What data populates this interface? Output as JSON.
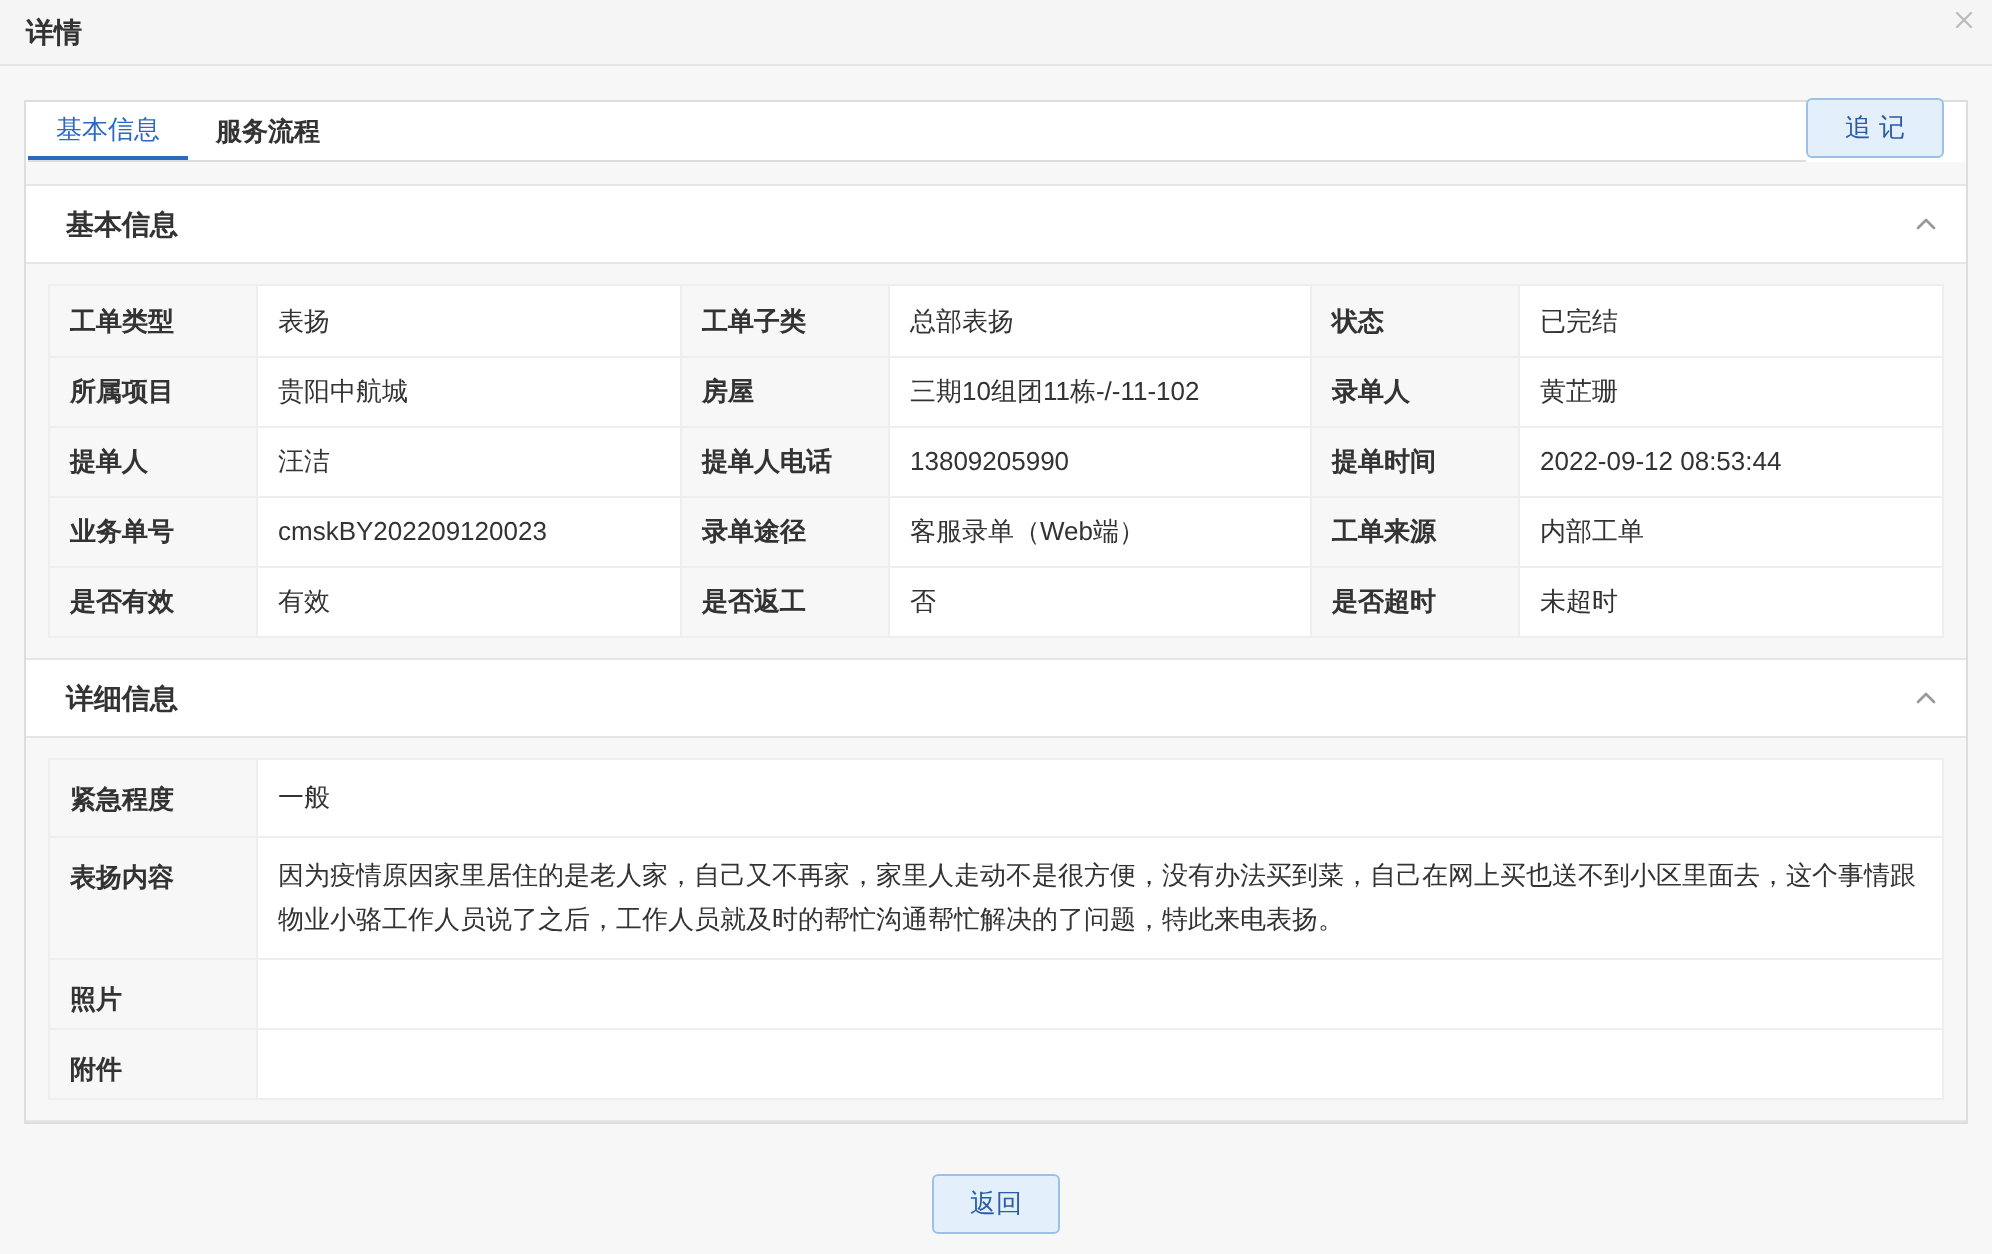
{
  "dialog": {
    "title": "详情"
  },
  "tabs": [
    {
      "label": "基本信息",
      "selected": true
    },
    {
      "label": "服务流程",
      "selected": false
    }
  ],
  "action_button": "追 记",
  "sections": [
    {
      "title": "基本信息",
      "expanded": true,
      "kind": "grid",
      "rows": [
        [
          {
            "label": "工单类型",
            "value": "表扬"
          },
          {
            "label": "工单子类",
            "value": "总部表扬"
          },
          {
            "label": "状态",
            "value": "已完结"
          }
        ],
        [
          {
            "label": "所属项目",
            "value": "贵阳中航城"
          },
          {
            "label": "房屋",
            "value": "三期10组团11栋-/-11-102"
          },
          {
            "label": "录单人",
            "value": "黄芷珊"
          }
        ],
        [
          {
            "label": "提单人",
            "value": "汪洁"
          },
          {
            "label": "提单人电话",
            "value": "13809205990"
          },
          {
            "label": "提单时间",
            "value": "2022-09-12 08:53:44"
          }
        ],
        [
          {
            "label": "业务单号",
            "value": "cmskBY202209120023"
          },
          {
            "label": "录单途径",
            "value": "客服录单（Web端）"
          },
          {
            "label": "工单来源",
            "value": "内部工单"
          }
        ],
        [
          {
            "label": "是否有效",
            "value": "有效"
          },
          {
            "label": "是否返工",
            "value": "否"
          },
          {
            "label": "是否超时",
            "value": "未超时"
          }
        ]
      ]
    },
    {
      "title": "详细信息",
      "expanded": true,
      "kind": "list",
      "rows": [
        {
          "label": "紧急程度",
          "value": "一般"
        },
        {
          "label": "表扬内容",
          "value": "因为疫情原因家里居住的是老人家，自己又不再家，家里人走动不是很方便，没有办法买到菜，自己在网上买也送不到小区里面去，这个事情跟物业小骆工作人员说了之后，工作人员就及时的帮忙沟通帮忙解决的了问题，特此来电表扬。"
        },
        {
          "label": "照片"
        },
        {
          "label": "附件"
        }
      ]
    }
  ],
  "footer_button": "返回"
}
